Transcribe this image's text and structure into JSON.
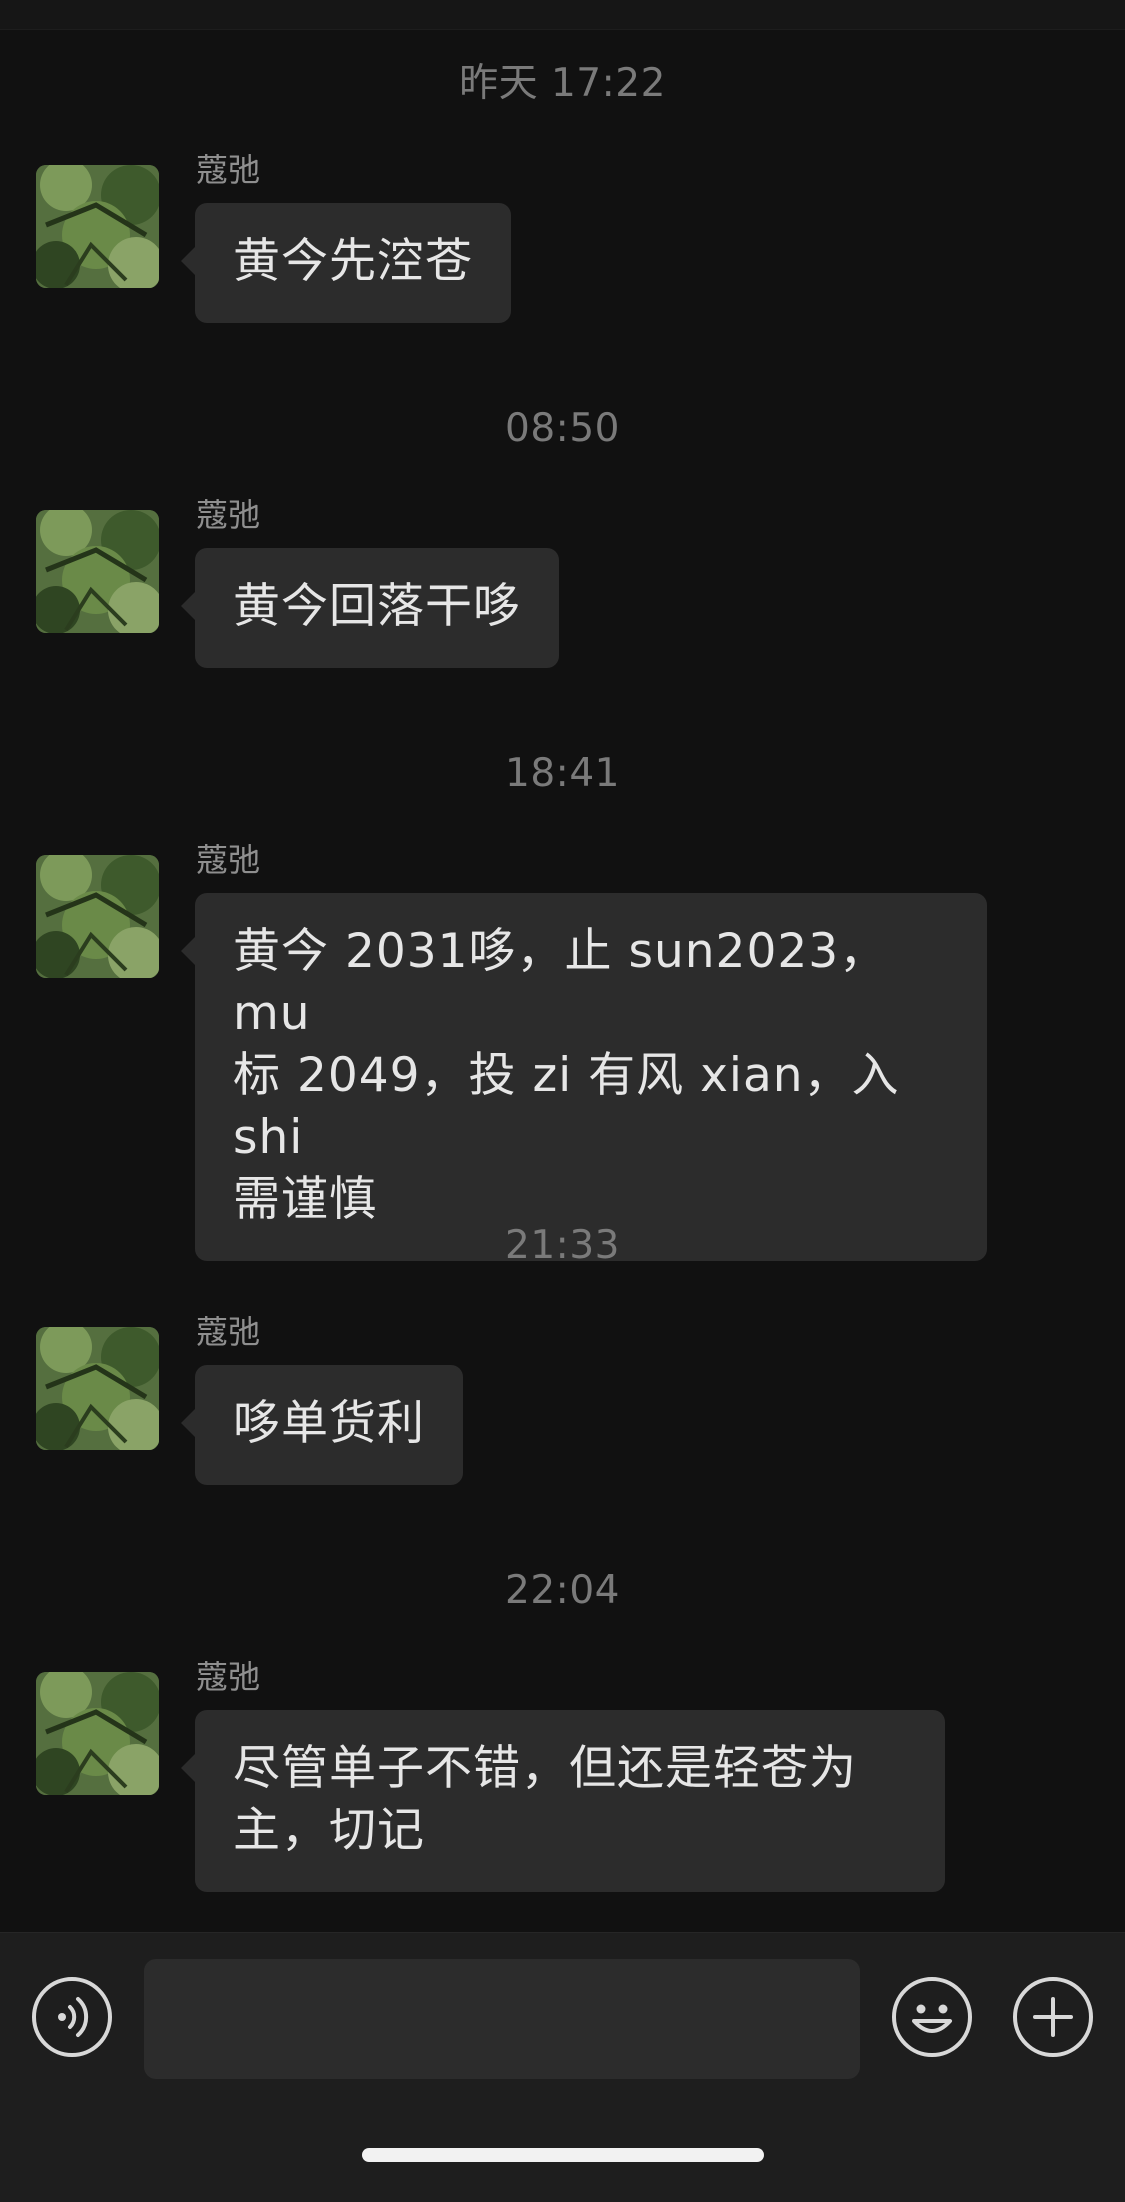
{
  "messages": [
    {
      "timestamp": "昨天 17:22",
      "sender": "蔻弛",
      "text": "黄今先涳苍"
    },
    {
      "timestamp": "08:50",
      "sender": "蔻弛",
      "text": "黄今回落干哆"
    },
    {
      "timestamp": "18:41",
      "sender": "蔻弛",
      "text": "黄今 2031哆，止 sun2023，mu\n标 2049，投 zi 有风 xian，入 shi\n需谨慎"
    },
    {
      "timestamp": "21:33",
      "sender": "蔻弛",
      "text": "哆单货利"
    },
    {
      "timestamp": "22:04",
      "sender": "蔻弛",
      "text": "尽管单子不错，但还是轻苍为\n主，切记"
    }
  ],
  "input": {
    "value": "",
    "placeholder": ""
  },
  "icons": {
    "voice": "voice-icon",
    "emoji": "emoji-icon",
    "plus": "plus-icon"
  },
  "colors": {
    "background": "#111111",
    "bubble": "#2c2c2c",
    "input_bar": "#1e1e1e"
  }
}
